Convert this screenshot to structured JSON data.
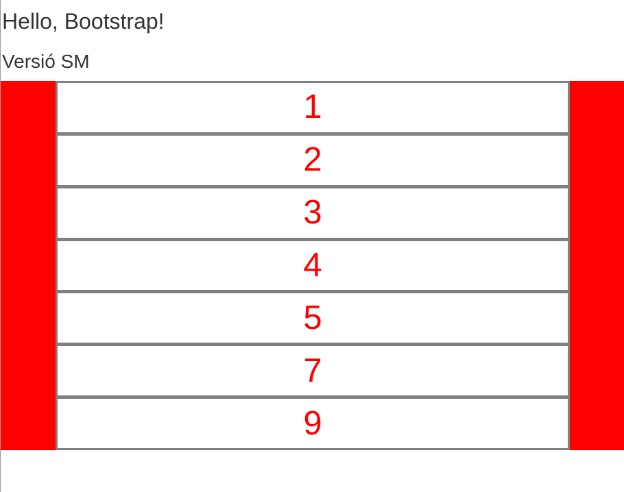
{
  "header": {
    "title": "Hello, Bootstrap!",
    "subtitle": "Versió SM"
  },
  "grid": {
    "items": [
      "1",
      "2",
      "3",
      "4",
      "5",
      "7",
      "9"
    ]
  },
  "colors": {
    "band": "#ff0000",
    "number": "#ff0000",
    "border": "#808080",
    "text": "#333333"
  }
}
